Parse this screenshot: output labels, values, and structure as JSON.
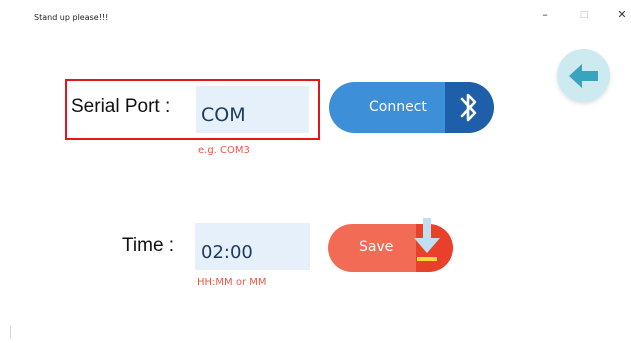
{
  "window": {
    "title": "Stand up please!!!",
    "minimize": "–",
    "maximize": "□",
    "close": "✕"
  },
  "serial": {
    "label": "Serial Port :",
    "value": "COM",
    "hint": "e.g. COM3",
    "connect_label": "Connect"
  },
  "time": {
    "label": "Time :",
    "value": "02:00",
    "hint": "HH:MM or MM",
    "save_label": "Save"
  },
  "icons": {
    "back": "arrow-left-icon",
    "bluetooth": "bluetooth-icon",
    "save": "download-arrow-icon"
  },
  "colors": {
    "connect": "#3d8fd8",
    "connect_accent": "#1f5ea8",
    "save": "#f26b55",
    "save_accent": "#e9402b",
    "hint": "#e8584a",
    "highlight": "#e0181b",
    "input_bg": "#e6f0fb"
  }
}
